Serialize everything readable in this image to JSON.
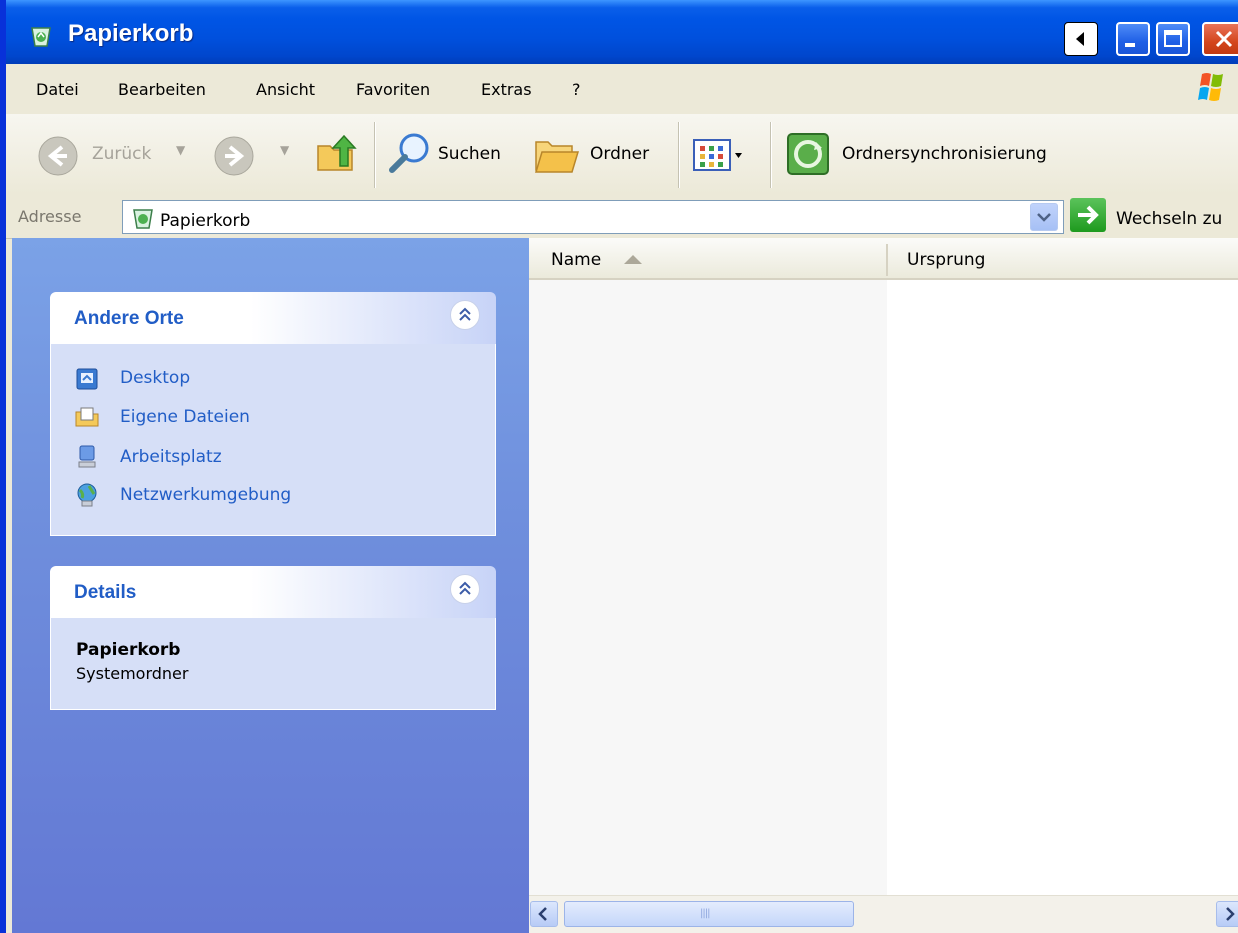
{
  "window": {
    "title": "Papierkorb"
  },
  "menu": {
    "items": [
      {
        "label": "Datei"
      },
      {
        "label": "Bearbeiten"
      },
      {
        "label": "Ansicht"
      },
      {
        "label": "Favoriten"
      },
      {
        "label": "Extras"
      },
      {
        "label": "?"
      }
    ]
  },
  "toolbar": {
    "back_label": "Zurück",
    "search_label": "Suchen",
    "folders_label": "Ordner",
    "sync_label": "Ordnersynchronisierung"
  },
  "address": {
    "label": "Adresse",
    "value": "Papierkorb",
    "go_label": "Wechseln zu"
  },
  "sidebar": {
    "other_places": {
      "title": "Andere Orte",
      "links": [
        {
          "label": "Desktop",
          "icon": "desktop-icon"
        },
        {
          "label": "Eigene Dateien",
          "icon": "my-documents-icon"
        },
        {
          "label": "Arbeitsplatz",
          "icon": "my-computer-icon"
        },
        {
          "label": "Netzwerkumgebung",
          "icon": "network-icon"
        }
      ]
    },
    "details": {
      "title": "Details",
      "name": "Papierkorb",
      "type": "Systemordner"
    }
  },
  "filelist": {
    "columns": [
      {
        "label": "Name",
        "sorted": "ascending"
      },
      {
        "label": "Ursprung"
      }
    ]
  },
  "colors": {
    "titlebar": "#0055E5",
    "link": "#215DC6",
    "sidebar_bg": "#6F8FDD"
  }
}
